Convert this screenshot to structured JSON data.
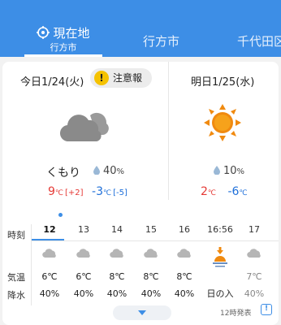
{
  "tabs": {
    "current": {
      "label": "現在地",
      "sub": "行方市"
    },
    "second": {
      "label": "行方市"
    },
    "third": {
      "label": "千代田区"
    }
  },
  "today": {
    "title": "今日1/24(火)",
    "warning": "注意報",
    "warning_icon": "!",
    "condition": "くもり",
    "rain": "40",
    "rain_unit": "%",
    "high": "9",
    "high_diff": "[+2]",
    "low": "-3",
    "low_diff": "[-5]",
    "unit": "℃",
    "icon": "cloud-icon"
  },
  "tomorrow": {
    "title": "明日1/25(水)",
    "rain": "10",
    "rain_unit": "%",
    "high": "2",
    "low": "-6",
    "unit": "℃",
    "icon": "sun-icon"
  },
  "hourly": {
    "labels": {
      "time": "時刻",
      "temp": "気温",
      "rain": "降水"
    },
    "cols": [
      {
        "hour": "12",
        "temp": "6℃",
        "rain": "40%"
      },
      {
        "hour": "13",
        "temp": "6℃",
        "rain": "40%"
      },
      {
        "hour": "14",
        "temp": "8℃",
        "rain": "40%"
      },
      {
        "hour": "15",
        "temp": "8℃",
        "rain": "40%"
      },
      {
        "hour": "16",
        "temp": "8℃",
        "rain": "40%"
      },
      {
        "hour": "16:56",
        "temp": "",
        "rain": "日の入"
      },
      {
        "hour": "17",
        "temp": "7℃",
        "rain": "40%"
      }
    ]
  },
  "footer": {
    "issued": "12時発表",
    "issued_icon": "!"
  },
  "colors": {
    "accent": "#3d8ee6",
    "high": "#e53935",
    "low": "#1e6fd9",
    "warning": "#f5c200",
    "sun": "#f08a10"
  }
}
